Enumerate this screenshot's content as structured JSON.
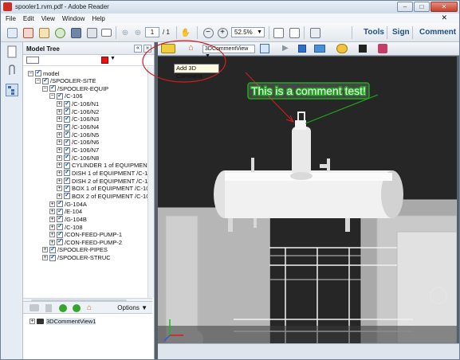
{
  "window": {
    "title": "spooler1.rvm.pdf - Adobe Reader"
  },
  "menu": [
    "File",
    "Edit",
    "View",
    "Window",
    "Help"
  ],
  "toolbar": {
    "page_current": "1",
    "page_total": "/ 1",
    "zoom": "52.5%",
    "tools_label": "Tools",
    "sign_label": "Sign",
    "comment_label": "Comment"
  },
  "panel": {
    "title": "Model Tree",
    "options_label": "Options"
  },
  "tree": [
    {
      "label": "model",
      "indent": 0,
      "exp": "−"
    },
    {
      "label": "/SPOOLER-SITE",
      "indent": 1,
      "exp": "−"
    },
    {
      "label": "/SPOOLER-EQUIP",
      "indent": 2,
      "exp": "−"
    },
    {
      "label": "/C-106",
      "indent": 3,
      "exp": "−"
    },
    {
      "label": "/C-106/N1",
      "indent": 4,
      "exp": "+"
    },
    {
      "label": "/C-106/N2",
      "indent": 4,
      "exp": "+"
    },
    {
      "label": "/C-106/N3",
      "indent": 4,
      "exp": "+"
    },
    {
      "label": "/C-106/N4",
      "indent": 4,
      "exp": "+"
    },
    {
      "label": "/C-106/N5",
      "indent": 4,
      "exp": "+"
    },
    {
      "label": "/C-106/N6",
      "indent": 4,
      "exp": "+"
    },
    {
      "label": "/C-106/N7",
      "indent": 4,
      "exp": "+"
    },
    {
      "label": "/C-106/N8",
      "indent": 4,
      "exp": "+"
    },
    {
      "label": "CYLINDER 1 of EQUIPMENT /C",
      "indent": 4,
      "exp": "+"
    },
    {
      "label": "DISH 1 of EQUIPMENT /C-106",
      "indent": 4,
      "exp": "+"
    },
    {
      "label": "DISH 2 of EQUIPMENT /C-106",
      "indent": 4,
      "exp": "+"
    },
    {
      "label": "BOX 1 of EQUIPMENT /C-106",
      "indent": 4,
      "exp": "+"
    },
    {
      "label": "BOX 2 of EQUIPMENT /C-106",
      "indent": 4,
      "exp": "+"
    },
    {
      "label": "/G-104A",
      "indent": 3,
      "exp": "+"
    },
    {
      "label": "/E-104",
      "indent": 3,
      "exp": "+"
    },
    {
      "label": "/G-104B",
      "indent": 3,
      "exp": "+"
    },
    {
      "label": "/C-108",
      "indent": 3,
      "exp": "+"
    },
    {
      "label": "/CON-FEED-PUMP-1",
      "indent": 3,
      "exp": "+"
    },
    {
      "label": "/CON-FEED-PUMP-2",
      "indent": 3,
      "exp": "+"
    },
    {
      "label": "/SPOOLER-PIPES",
      "indent": 2,
      "exp": "+"
    },
    {
      "label": "/SPOOLER-STRUC",
      "indent": 2,
      "exp": "+"
    }
  ],
  "views": [
    {
      "label": "3DCommentView1"
    }
  ],
  "toolbar3d": {
    "view_select": "3DCommentView"
  },
  "tooltip": "Add 3D Comment",
  "comment_text": "This is a comment test!",
  "colors": {
    "comment_green": "#1ea81e",
    "annotation_red": "#d21f1f",
    "title_blue": "#1f4f86"
  }
}
